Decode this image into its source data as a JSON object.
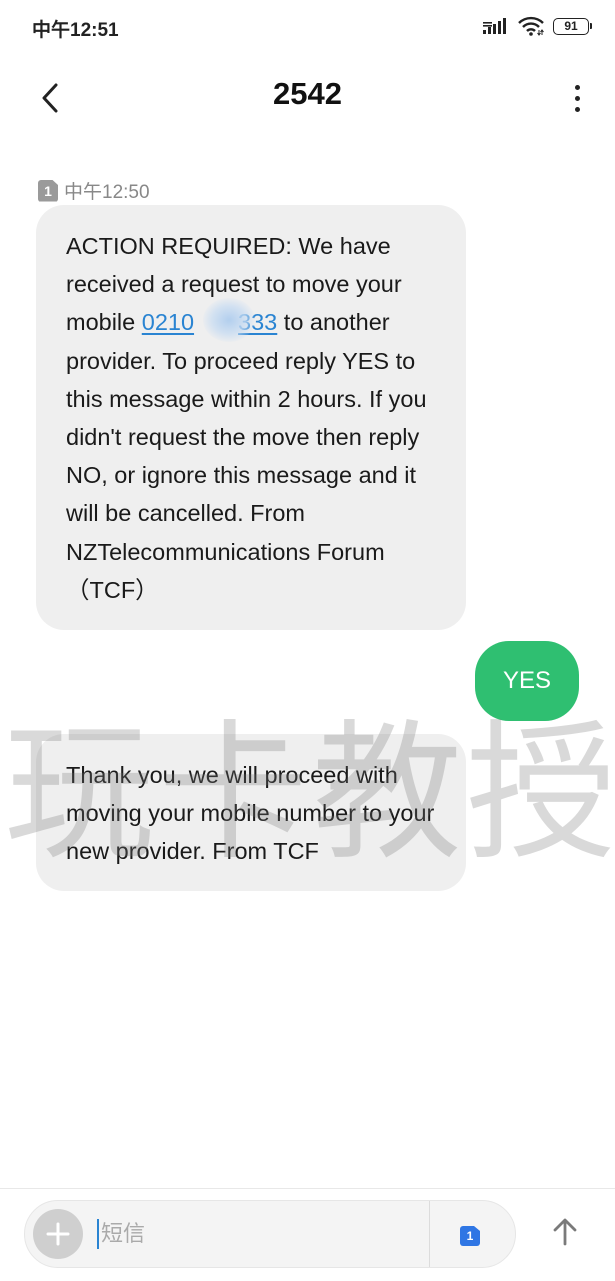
{
  "status_bar": {
    "time": "中午12:51",
    "battery": "91"
  },
  "header": {
    "title": "2542"
  },
  "thread": {
    "timestamp": "中午12:50",
    "sim_badge": "1",
    "message_1": {
      "part_1": "ACTION REQUIRED: We have received a request to move your mobile ",
      "phone_start": "0210",
      "phone_end": "333",
      "part_2": " to another provider. To proceed reply YES to this message within 2 hours. If you didn't request the move then reply NO, or ignore this message and it will be cancelled. From NZTelecommunications Forum（TCF）"
    },
    "reply": "YES",
    "message_2": "Thank you, we will proceed with moving your mobile number to your new provider. From TCF"
  },
  "watermark": "玩卡教授",
  "composer": {
    "placeholder": "短信",
    "sim": "1"
  },
  "colors": {
    "outgoing_bubble": "#2fbf71",
    "incoming_bubble": "#efefef",
    "link": "#2a84d2",
    "sim_badge": "#2f76e4"
  }
}
